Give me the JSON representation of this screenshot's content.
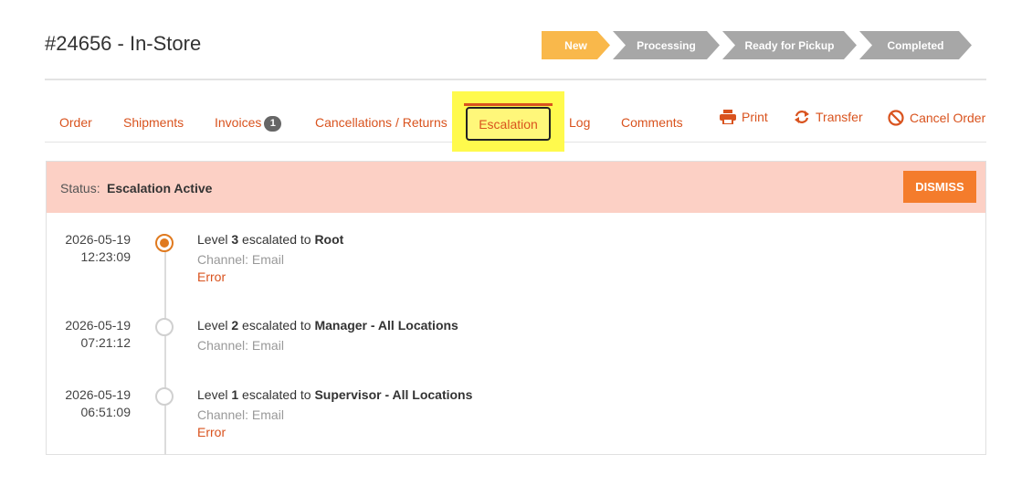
{
  "order": {
    "title": "#24656 - In-Store"
  },
  "progress_steps": [
    {
      "label": "New",
      "state": "active"
    },
    {
      "label": "Processing",
      "state": "inactive"
    },
    {
      "label": "Ready for Pickup",
      "state": "inactive"
    },
    {
      "label": "Completed",
      "state": "inactive"
    }
  ],
  "tabs": {
    "order": "Order",
    "shipments": "Shipments",
    "invoices": "Invoices",
    "invoices_count": "1",
    "cancellations": "Cancellations / Returns",
    "escalation": "Escalation",
    "log": "Log",
    "comments": "Comments"
  },
  "actions": {
    "print": "Print",
    "transfer": "Transfer",
    "cancel_order": "Cancel Order"
  },
  "status": {
    "label": "Status:",
    "value": "Escalation Active",
    "dismiss": "DISMISS"
  },
  "escalations": [
    {
      "date": "2026-05-19",
      "time": "12:23:09",
      "level_prefix": "Level",
      "level": "3",
      "escalated_to_text": "escalated to",
      "target": "Root",
      "channel": "Channel: Email",
      "error": "Error",
      "active": true
    },
    {
      "date": "2026-05-19",
      "time": "07:21:12",
      "level_prefix": "Level",
      "level": "2",
      "escalated_to_text": "escalated to",
      "target": "Manager - All Locations",
      "channel": "Channel: Email",
      "error": "",
      "active": false
    },
    {
      "date": "2026-05-19",
      "time": "06:51:09",
      "level_prefix": "Level",
      "level": "1",
      "escalated_to_text": "escalated to",
      "target": "Supervisor - All Locations",
      "channel": "Channel: Email",
      "error": "Error",
      "active": false
    }
  ],
  "colors": {
    "accent": "#d9531e",
    "step_active": "#f9b84b",
    "step_inactive": "#a7a7a7",
    "status_bg": "#fcd0c5",
    "dismiss_bg": "#f47c2c",
    "highlight": "#fffa4d"
  },
  "icons": {
    "print": "printer-icon",
    "transfer": "transfer-icon",
    "cancel": "cancel-circle-icon"
  }
}
